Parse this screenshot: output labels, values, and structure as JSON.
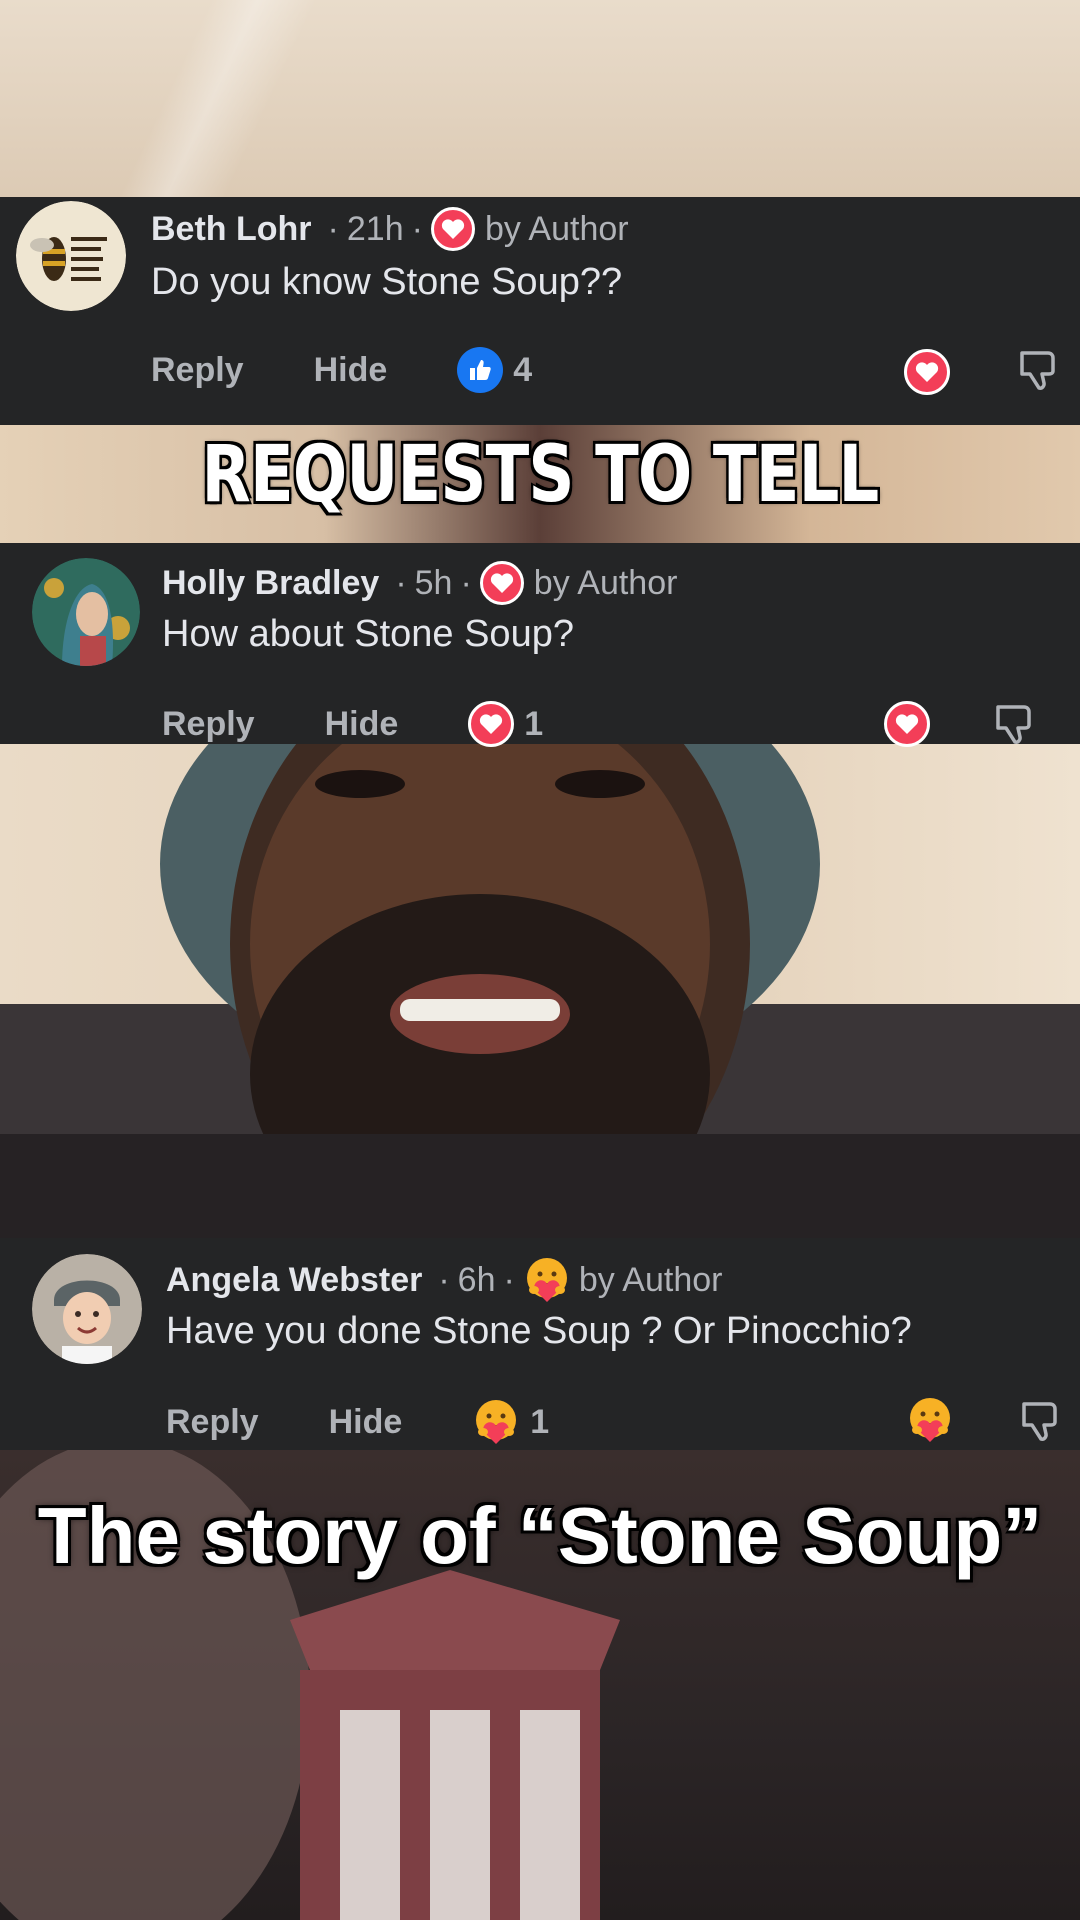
{
  "comments": [
    {
      "name": "Beth Lohr",
      "time": "21h",
      "sep": "·",
      "author_label": "by Author",
      "text": "Do you know Stone Soup??",
      "reply": "Reply",
      "hide": "Hide",
      "reaction_count": "4",
      "reaction_type": "like-icon",
      "author_reaction": "love-icon"
    },
    {
      "name": "Holly Bradley",
      "time": "5h",
      "sep": "·",
      "author_label": "by Author",
      "text": "How about Stone Soup?",
      "reply": "Reply",
      "hide": "Hide",
      "reaction_count": "1",
      "reaction_type": "love-icon",
      "author_reaction": "love-icon"
    },
    {
      "name": "Angela Webster",
      "time": "6h",
      "sep": "·",
      "author_label": "by Author",
      "text": "Have you done Stone Soup ? Or Pinocchio?",
      "reply": "Reply",
      "hide": "Hide",
      "reaction_count": "1",
      "reaction_type": "care-icon",
      "author_reaction": "care-icon"
    }
  ],
  "overlays": {
    "headline": "REQUESTS TO TELL",
    "caption": "The story of “Stone Soup”"
  },
  "colors": {
    "panel_bg": "#242526",
    "love": "#f33e58",
    "like": "#1877f2",
    "muted_text": "#b0b3b8",
    "primary_text": "#e4e6eb"
  }
}
